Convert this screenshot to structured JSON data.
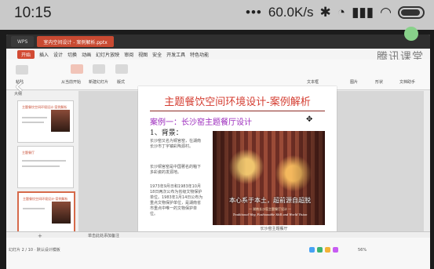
{
  "status_bar": {
    "time": "10:15",
    "speed": "60.0K/s",
    "icons": [
      "dots",
      "bluetooth",
      "alarm",
      "signal",
      "wifi",
      "battery"
    ]
  },
  "app": {
    "tabs": [
      {
        "label": "WPS"
      },
      {
        "label": "室内空间设计 - 案例解析.pptx"
      }
    ],
    "menu": [
      "开始",
      "插入",
      "设计",
      "切换",
      "动画",
      "幻灯片放映",
      "审阅",
      "视图",
      "安全",
      "开发工具",
      "特色功能"
    ],
    "watermark": "腾讯课堂",
    "ribbon_labels": [
      "粘贴",
      "从当前开始",
      "新建幻灯片",
      "版式",
      "文本框",
      "图片",
      "形状",
      "文档助手"
    ],
    "sidebar": {
      "header": "大纲",
      "tabs": [
        "大纲",
        "幻灯片"
      ],
      "slides": [
        {
          "title": "主题餐饮空间环境设计-案例解析"
        },
        {
          "title": "主题餐厅"
        },
        {
          "title": "主题餐饮空间环境设计-案例解析"
        }
      ]
    },
    "slide": {
      "title": "主题餐饮空间环境设计-案例解析",
      "case_title": "案例一：长沙窑主题餐厅设计",
      "background_title": "1、背景：",
      "paragraphs": [
        "长沙窑又名为铜官窑，在湖南长沙市丁字镇彩陶源村。",
        "长沙铜官窑是中国著名的釉下多彩瓷的发源地。",
        "1973年9月日和1983年10月18日两次公布为省级文物保护单位。1983年1月14日公布为重点文物保护单位，是湖南省市重点中唯一的文物保护单位。"
      ],
      "photo_slogan": "本心系于本土，超前源自超脱",
      "photo_subslogan": "一 湖南长沙窑主题餐厅设计 一",
      "photo_english": "Traditional Way, Fashionable Skill and World Vision",
      "photo_caption": "长沙窑主题餐厅"
    },
    "bottom": {
      "add_label": "+",
      "notes_label": "单击此处添加备注",
      "status_text": "幻灯片 2 / 10 · 默认设计模板",
      "zoom": "56%"
    }
  }
}
